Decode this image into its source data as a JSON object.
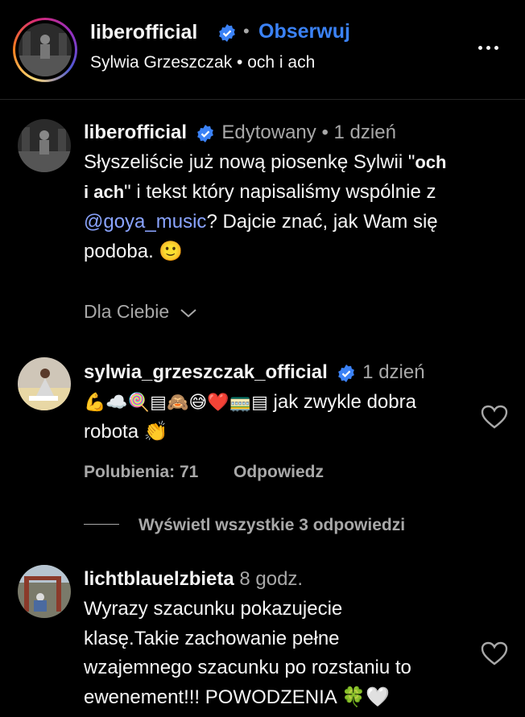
{
  "header": {
    "username": "liberofficial",
    "separator": "•",
    "follow_label": "Obserwuj",
    "subtitle": "Sylwia Grzeszczak • och i ach"
  },
  "post": {
    "username": "liberofficial",
    "edited": "Edytowany",
    "separator": "•",
    "time": "1 dzień",
    "line1": "Słyszeliście już nową piosenkę Sylwii \"",
    "line1_bold": "och",
    "line2_bold": "i ach",
    "line2": "\" i tekst który napisaliśmy wspólnie z",
    "mention": "@goya_music",
    "line3_rest": "? Dajcie znać, jak Wam się",
    "line4": "podoba. 🙂",
    "sort_label": "Dla Ciebie"
  },
  "comments": [
    {
      "username": "sylwia_grzeszczak_official",
      "time": "1 dzień",
      "line1_emoji": "💪☁️🍭▤🙈😅❤️🚃▤",
      "line1_text": " jak zwykle dobra",
      "line2": "robota 👏",
      "likes_label": "Polubienia: 71",
      "reply_label": "Odpowiedz",
      "view_replies": "Wyświetl wszystkie 3 odpowiedzi"
    },
    {
      "username": "lichtblauelzbieta",
      "time": "8 godz.",
      "line1": "Wyrazy szacunku pokazujecie",
      "line2": "klasę.Takie zachowanie pełne",
      "line3": "wzajemnego szacunku po rozstaniu to",
      "line4": "ewenement!!! POWODZENIA 🍀🤍"
    }
  ],
  "colors": {
    "background": "#000000",
    "accent_blue": "#3b82f6",
    "secondary_text": "#a8a8a8",
    "mention": "#8aa4ff"
  }
}
